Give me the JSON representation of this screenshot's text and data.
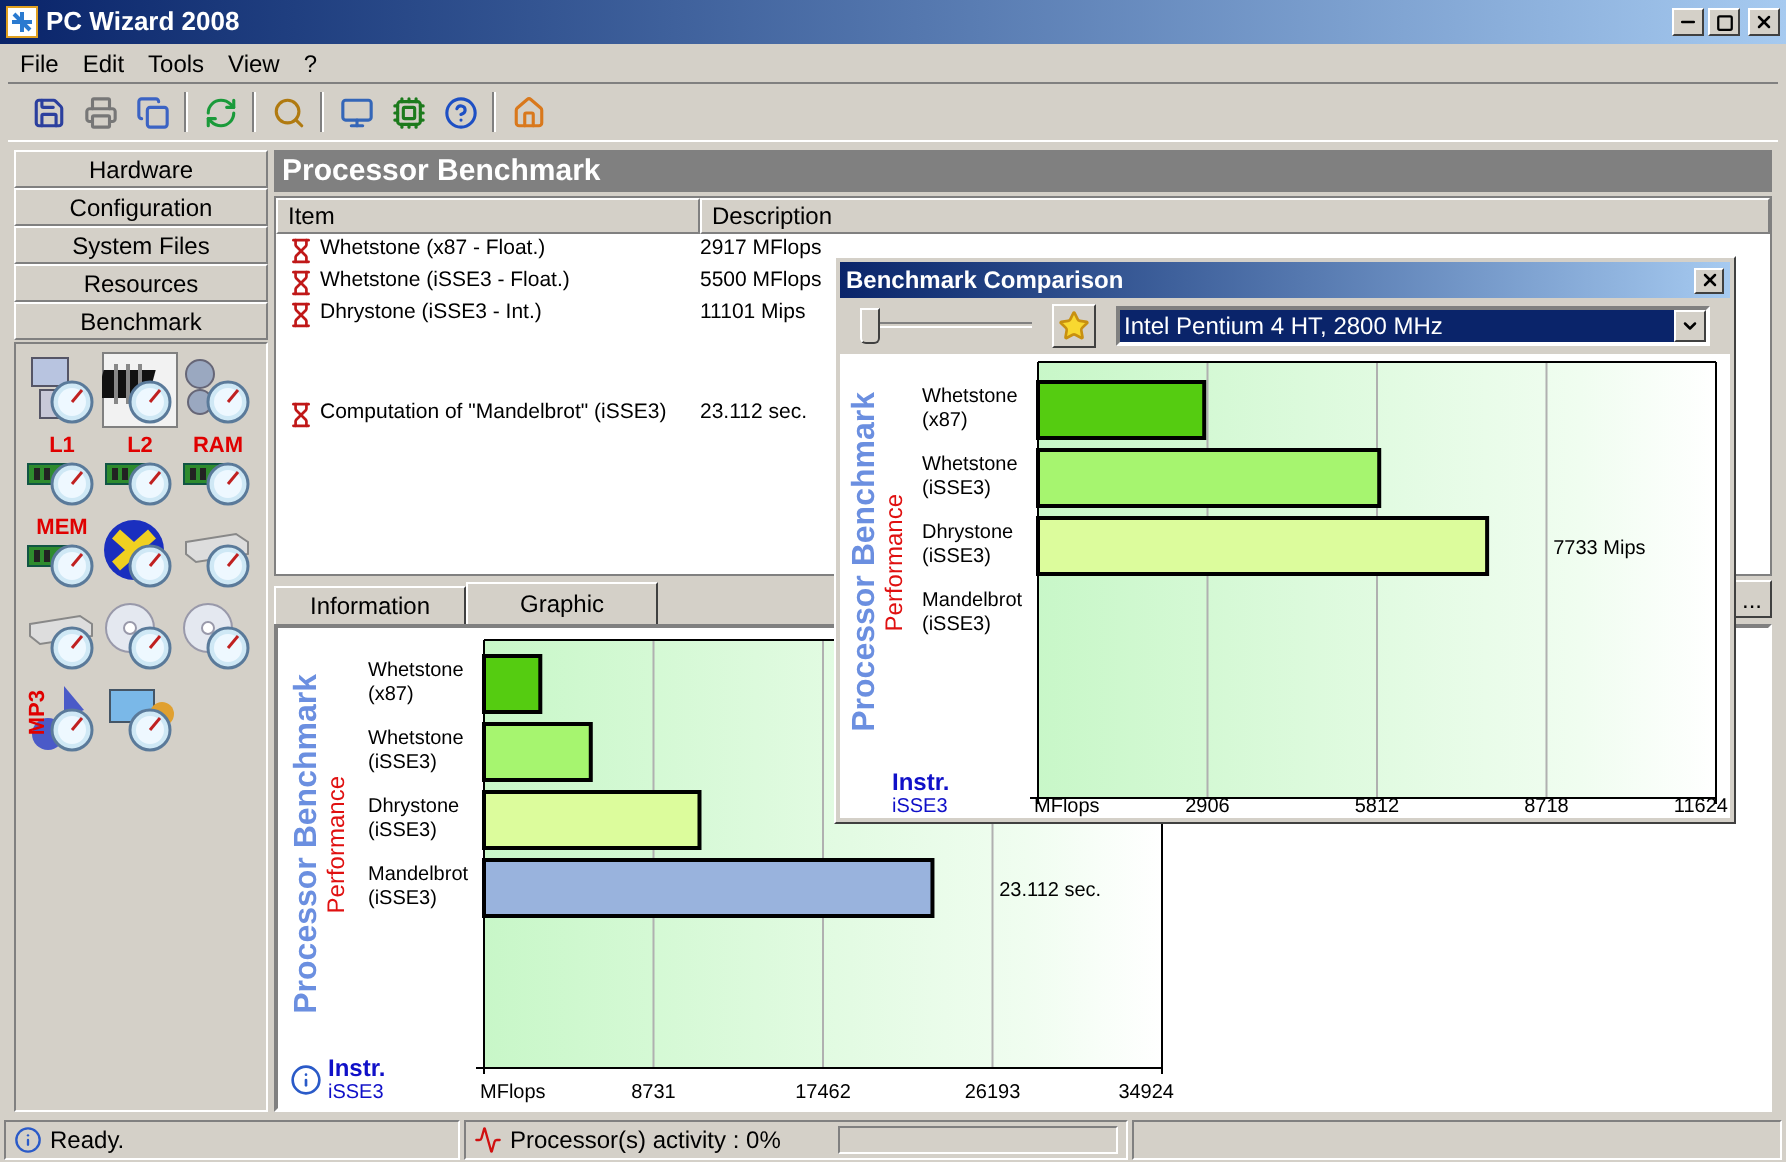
{
  "window": {
    "title": "PC Wizard 2008"
  },
  "menu": [
    "File",
    "Edit",
    "Tools",
    "View",
    "?"
  ],
  "toolbar": [
    {
      "kind": "save"
    },
    {
      "kind": "print"
    },
    {
      "kind": "copy"
    },
    {
      "kind": "separator"
    },
    {
      "kind": "refresh"
    },
    {
      "kind": "separator"
    },
    {
      "kind": "search"
    },
    {
      "kind": "separator"
    },
    {
      "kind": "computer"
    },
    {
      "kind": "chip"
    },
    {
      "kind": "help"
    },
    {
      "kind": "separator"
    },
    {
      "kind": "home"
    }
  ],
  "sidebar": {
    "categories": [
      "Hardware",
      "Configuration",
      "System Files",
      "Resources",
      "Benchmark"
    ],
    "tools": [
      {
        "kind": "computer",
        "selected": false
      },
      {
        "kind": "chip",
        "selected": true
      },
      {
        "kind": "gears",
        "selected": false
      },
      {
        "kind": "memory",
        "label": "L1",
        "selected": false
      },
      {
        "kind": "memory",
        "label": "L2",
        "selected": false
      },
      {
        "kind": "memory",
        "label": "RAM",
        "selected": false
      },
      {
        "kind": "memory",
        "label": "MEM",
        "selected": false
      },
      {
        "kind": "cross",
        "selected": false
      },
      {
        "kind": "drive",
        "selected": false
      },
      {
        "kind": "drive",
        "selected": false
      },
      {
        "kind": "cd",
        "selected": false
      },
      {
        "kind": "cd",
        "selected": false
      },
      {
        "kind": "mp3",
        "label": "MP3",
        "selected": false
      },
      {
        "kind": "media",
        "selected": false
      }
    ]
  },
  "panel": {
    "title": "Processor Benchmark",
    "table": {
      "columns": [
        "Item",
        "Description"
      ],
      "rows": [
        {
          "kind": "test",
          "item": "Whetstone (x87 - Float.)",
          "description": "2917 MFlops"
        },
        {
          "kind": "test",
          "item": "Whetstone (iSSE3 - Float.)",
          "description": "5500 MFlops"
        },
        {
          "kind": "test",
          "item": "Dhrystone (iSSE3 - Int.)",
          "description": "11101 Mips"
        },
        {
          "kind": "computation",
          "item": "Computation of \"Mandelbrot\" (iSSE3)",
          "description": "23.112 sec."
        }
      ]
    },
    "tabs": [
      {
        "label": "Information",
        "selected": false
      },
      {
        "label": "Graphic",
        "selected": true
      }
    ],
    "more_button": "...",
    "chart": {
      "title": "Processor Benchmark",
      "subtitle": "Performance",
      "legend_title": "Instr.",
      "legend_value": "iSSE3",
      "chart_data": {
        "type": "bar",
        "orientation": "horizontal",
        "categories": [
          "Whetstone (x87)",
          "Whetstone (iSSE3)",
          "Dhrystone (iSSE3)",
          "Mandelbrot (iSSE3)"
        ],
        "values": [
          2900,
          5500,
          11100,
          23100
        ],
        "colors": [
          "#55cc11",
          "#a6f56f",
          "#dcfc9c",
          "#99b3dd"
        ],
        "grid": true,
        "xlim": [
          0,
          34924
        ],
        "xticks": [
          {
            "value": 0,
            "label": "MFlops"
          },
          8731,
          17462,
          26193,
          34924
        ],
        "annotations": [
          "23.112 sec."
        ]
      }
    }
  },
  "dialog": {
    "title": "Benchmark Comparison",
    "slider": {
      "level": 0
    },
    "processor": "Intel Pentium 4 HT, 2800 MHz",
    "chart": {
      "title": "Processor Benchmark",
      "subtitle": "Performance",
      "legend_title": "Instr.",
      "legend_value": "iSSE3",
      "chart_data": {
        "type": "bar",
        "orientation": "horizontal",
        "categories": [
          "Whetstone (x87)",
          "Whetstone (iSSE3)",
          "Dhrystone (iSSE3)",
          "Mandelbrot (iSSE3)"
        ],
        "values": [
          2850,
          5850,
          7700,
          null
        ],
        "colors": [
          "#55cc11",
          "#a6f56f",
          "#dcfc9c",
          "#99b3dd"
        ],
        "grid": true,
        "xlim": [
          0,
          11624
        ],
        "xticks": [
          {
            "value": 0,
            "label": "MFlops"
          },
          2906,
          5812,
          8718,
          11624
        ],
        "annotations": [
          "7733 Mips"
        ]
      }
    }
  },
  "status_bar": {
    "message": "Ready.",
    "activity": "Processor(s) activity : 0%"
  }
}
